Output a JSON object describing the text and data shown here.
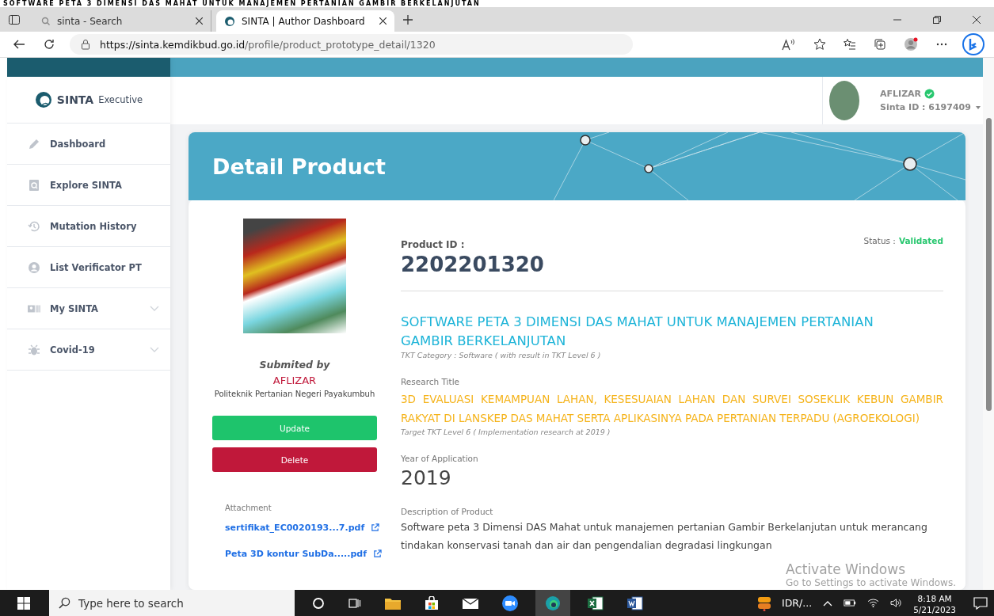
{
  "overlay_caption": "SOFTWARE PETA 3 DIMENSI DAS MAHAT UNTUK MANAJEMEN PERTANIAN GAMBIR BERKELANJUTAN",
  "browser": {
    "tabs": [
      {
        "title": "sinta - Search",
        "selected": false
      },
      {
        "title": "SINTA | Author Dashboard",
        "selected": true
      }
    ],
    "url_host": "https://sinta.kemdikbud.go.id",
    "url_path": "/profile/product_prototype_detail/1320"
  },
  "sidebar": {
    "brand": "SINTA",
    "brand_sub": "Executive",
    "items": [
      {
        "label": "Dashboard",
        "kind": "pencil",
        "has_submenu": false
      },
      {
        "label": "Explore SINTA",
        "kind": "search",
        "has_submenu": false
      },
      {
        "label": "Mutation History",
        "kind": "history",
        "has_submenu": false
      },
      {
        "label": "List Verificator PT",
        "kind": "user",
        "has_submenu": false
      },
      {
        "label": "My SINTA",
        "kind": "card",
        "has_submenu": true
      },
      {
        "label": "Covid-19",
        "kind": "bug",
        "has_submenu": true
      }
    ]
  },
  "user": {
    "name": "AFLIZAR",
    "verified": true,
    "sinta_id": "Sinta ID : 6197409"
  },
  "page_title": "Detail Product",
  "submitter": {
    "label": "Submited by",
    "name": "AFLIZAR",
    "institution": "Politeknik Pertanian Negeri Payakumbuh"
  },
  "actions": [
    {
      "label": "Update",
      "kind": "update"
    },
    {
      "label": "Delete",
      "kind": "delete"
    }
  ],
  "attachment": {
    "label": "Attachment",
    "files": [
      "sertifikat_EC0020193...7.pdf",
      "Peta 3D kontur SubDa.....pdf"
    ]
  },
  "product": {
    "id_label": "Product ID :",
    "id": "2202201320",
    "status_label": "Status :",
    "status": "Validated",
    "title": "SOFTWARE PETA 3 DIMENSI DAS MAHAT UNTUK MANAJEMEN PERTANIAN GAMBIR BERKELANJUTAN",
    "tkt_category": "TKT Category : Software ( with result in TKT Level  6 )",
    "research_label": "Research Title",
    "research_title": "3D EVALUASI KEMAMPUAN LAHAN, KESESUAIAN LAHAN DAN SURVEI SOSEKLIK KEBUN GAMBIR RAKYAT DI LANSKEP DAS MAHAT SERTA APLIKASINYA PADA PERTANIAN TERPADU (AGROEKOLOGI)",
    "target": "Target TKT Level 6 ( Implementation research at  2019 )",
    "year_label": "Year of Application",
    "year": "2019",
    "description_label": "Description of Product",
    "description": "Software peta 3 Dimensi DAS Mahat untuk manajemen pertanian Gambir Berkelanjutan untuk merancang tindakan konservasi tanah dan air dan pengendalian degradasi lingkungan"
  },
  "watermark": {
    "title": "Activate Windows",
    "subtitle": "Go to Settings to activate Windows."
  },
  "taskbar": {
    "search_placeholder": "Type here to search",
    "tray_label": "IDR/...",
    "time": "8:18 AM",
    "date": "5/21/2023"
  }
}
